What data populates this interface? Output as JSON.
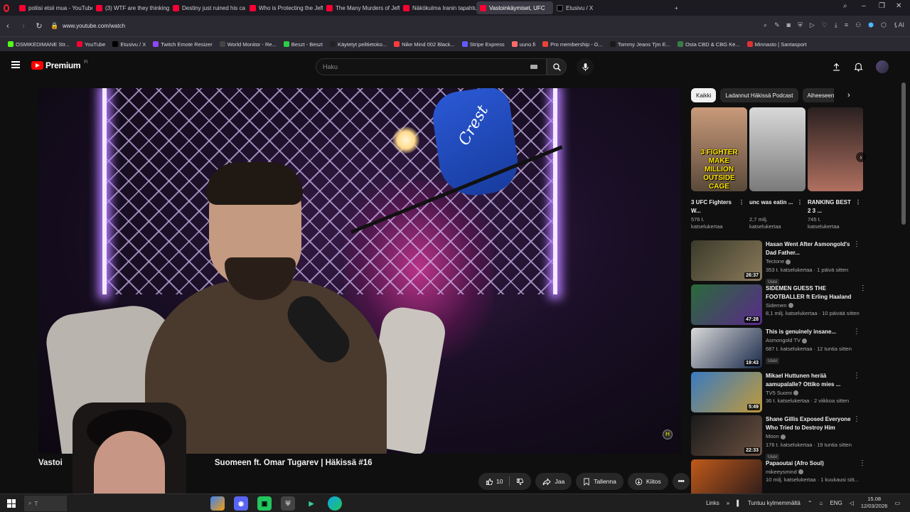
{
  "browser": {
    "tabs": [
      {
        "label": "poliisi etsii mua - YouTube",
        "fav": "red",
        "active": false
      },
      {
        "label": "(3) WTF are they thinking",
        "fav": "red",
        "active": false
      },
      {
        "label": "Destiny just ruined his ca",
        "fav": "red",
        "active": false
      },
      {
        "label": "Who is Protecting the Jeff",
        "fav": "red",
        "active": false
      },
      {
        "label": "The Many Murders of Jeffr",
        "fav": "red",
        "active": false
      },
      {
        "label": "Näkökulma Iranin tapahtu",
        "fav": "red",
        "active": false
      },
      {
        "label": "Vastoinkäymiset, UFC",
        "fav": "red",
        "active": true
      },
      {
        "label": "Etusivu / X",
        "fav": "x",
        "active": false
      }
    ],
    "new_tab_label": "+",
    "url": "www.youtube.com/watch",
    "bookmarks": [
      {
        "label": "OSMIKEDIMANE Str...",
        "color": "#53fc18"
      },
      {
        "label": "YouTube",
        "color": "#ff0033"
      },
      {
        "label": "Etusivu / X",
        "color": "#000000"
      },
      {
        "label": "Twitch Emote Resizer",
        "color": "#9146ff"
      },
      {
        "label": "World Monitor - Re...",
        "color": "#444444"
      },
      {
        "label": "Beszt - Beszt",
        "color": "#2ecc40"
      },
      {
        "label": "Käytetyt pelitietoko...",
        "color": "#222222"
      },
      {
        "label": "Nike Mind 002 Black...",
        "color": "#ff3b3b"
      },
      {
        "label": "Stripe Express",
        "color": "#635bff"
      },
      {
        "label": "uuno.fi",
        "color": "#ff6b6b"
      },
      {
        "label": "Pro membership - G...",
        "color": "#ea4335"
      },
      {
        "label": "Tommy Jeans Tjm E...",
        "color": "#1a1a1a"
      },
      {
        "label": "Osta CBD & CBG Ke...",
        "color": "#3a7d44"
      },
      {
        "label": "Minnasto | Santasport",
        "color": "#e03131"
      }
    ]
  },
  "youtube": {
    "logo_text": "Premium",
    "logo_sup": "FI",
    "search_placeholder": "Haku",
    "video": {
      "title_visible_start": "Vastoi",
      "title_visible_end": "Suomeen ft. Omar Tugarev | Häkissä #16",
      "like_count": "10",
      "share_label": "Jaa",
      "save_label": "Tallenna",
      "thanks_label": "Kiitos"
    },
    "chips": [
      "Kaikki",
      "Ladannut Häkissä Podcast",
      "Aiheeseen"
    ],
    "shorts": [
      {
        "title": "3 UFC Fighters W...",
        "views": "576 t.",
        "views2": "katselukertaa",
        "thumb_text": "3 FIGHTER MAKE MILLION OUTSIDE CAGE",
        "bg1": "#c99a7a",
        "bg2": "#5a4a3a"
      },
      {
        "title": "unc was eatin ...",
        "views": "2,7 milj.",
        "views2": "katselukertaa",
        "thumb_text": "",
        "bg1": "#d9d9d9",
        "bg2": "#7a7a7a"
      },
      {
        "title": "RANKING BEST 2 3 ...",
        "views": "745 t.",
        "views2": "katselukertaa",
        "thumb_text": "",
        "bg1": "#2a2020",
        "bg2": "#b07060"
      }
    ],
    "recommendations": [
      {
        "title": "Hasan Went After Asmongold's Dad Father...",
        "channel": "Tectone",
        "meta": "353 t. katselukertaa · 1 päivä sitten",
        "badge": "Uusi",
        "duration": "26:37",
        "bg1": "#3a3a2a",
        "bg2": "#8a7a5a"
      },
      {
        "title": "SIDEMEN GUESS THE FOOTBALLER ft Erling Haaland",
        "channel": "Sidemen",
        "meta": "8,1 milj. katselukertaa · 10 päivää sitten",
        "badge": "",
        "duration": "47:28",
        "bg1": "#2a6a3a",
        "bg2": "#5a2a8a"
      },
      {
        "title": "This is genuinely insane...",
        "channel": "Asmongold TV",
        "meta": "687 t. katselukertaa · 12 tuntia sitten",
        "badge": "Uusi",
        "duration": "19:43",
        "bg1": "#d9d9d9",
        "bg2": "#1a2a4a"
      },
      {
        "title": "Mikael Huttunen herää aamupalalle? Ottiko mies ...",
        "channel": "TV5 Suomi",
        "meta": "36 t. katselukertaa · 2 viikkoa sitten",
        "badge": "",
        "duration": "5:49",
        "bg1": "#3a7ac0",
        "bg2": "#c09a3a"
      },
      {
        "title": "Shane Gillis Exposed Everyone Who Tried to Destroy Him",
        "channel": "Moon",
        "meta": "176 t. katselukertaa · 19 tuntia sitten",
        "badge": "Uusi",
        "duration": "22:33",
        "bg1": "#1a1a1a",
        "bg2": "#6a5040"
      },
      {
        "title": "Papaoutai (Afro Soul)",
        "channel": "mikeeysmind",
        "meta": "10 milj. katselukertaa · 1 kuukausi sitt...",
        "badge": "",
        "duration": "",
        "bg1": "#c05a1a",
        "bg2": "#2a1a1a"
      }
    ]
  },
  "taskbar": {
    "search_text": "T",
    "tray_links": "Links",
    "weather": "Tuntuu kylmemmältä",
    "language": "ENG",
    "time": "15.08",
    "date": "12/03/2026"
  },
  "colors": {
    "youtube_red": "#ff0000",
    "bg": "#0f0f0f",
    "chip_bg": "#272727"
  }
}
